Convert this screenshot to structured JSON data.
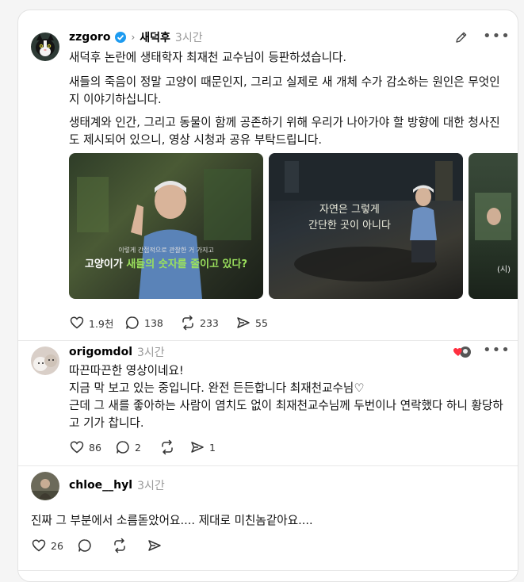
{
  "post": {
    "username": "zzgoro",
    "topic": "새덕후",
    "time": "3시간",
    "text1": "새덕후 논란에 생태학자 최재천 교수님이 등판하셨습니다.",
    "text2": "새들의 죽음이 정말 고양이 때문인지, 그리고 실제로 새 개체 수가 감소하는 원인은 무엇인지 이야기하십니다.",
    "text3": "생태계와 인간, 그리고 동물이 함께 공존하기 위해 우리가 나아가야 할 방향에 대한 청사진도 제시되어 있으니, 영상 시청과 공유 부탁드립니다.",
    "media": {
      "v1_small": "이렇게 간접적으로 관찰한 거 가지고",
      "v1_main_a": "고양이가 ",
      "v1_main_b": "새들의 숫자를 줄이고 있다?",
      "v2_line1": "자연은 그렇게",
      "v2_line2": "간단한 곳이 아니다",
      "v3_text": "(시)"
    },
    "likes": "1.9천",
    "comments": "138",
    "reposts": "233",
    "shares": "55"
  },
  "reply1": {
    "username": "origomdol",
    "time": "3시간",
    "line1": "따끈따끈한 영상이네요!",
    "line2": "지금 막 보고 있는 중입니다. 완전 든든합니다 최재천교수님♡",
    "line3": "근데 그 새를 좋아하는 사람이 염치도 없이 최재천교수님께 두번이나 연락했다 하니 황당하고 기가 찹니다.",
    "likes": "86",
    "comments": "2",
    "shares": "1"
  },
  "reply2": {
    "username": "chloe__hyl",
    "time": "3시간",
    "text": "진짜 그 부분에서 소름돋았어요.... 제대로 미친놈같아요....",
    "likes": "26"
  },
  "icons": {
    "more": "•••"
  }
}
